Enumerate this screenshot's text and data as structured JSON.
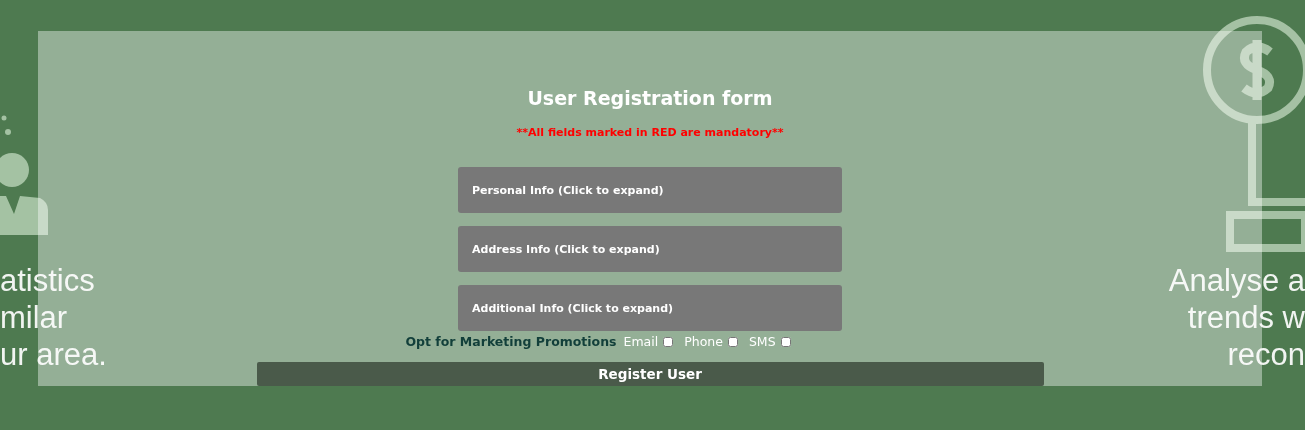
{
  "background": {
    "left_lines": [
      "atistics",
      "milar",
      "ur area."
    ],
    "right_lines": [
      "Analyse a",
      "trends w",
      "recon"
    ]
  },
  "form": {
    "title": "User Registration form",
    "notice": "**All fields marked in RED are mandatory**",
    "sections": [
      {
        "label": "Personal Info (Click to expand)"
      },
      {
        "label": "Address Info (Click to expand)"
      },
      {
        "label": "Additional Info (Click to expand)"
      }
    ],
    "marketing": {
      "label": "Opt for Marketing Promotions",
      "options": [
        {
          "label": "Email",
          "checked": false
        },
        {
          "label": "Phone",
          "checked": false
        },
        {
          "label": "SMS",
          "checked": false
        }
      ]
    },
    "submit": "Register User"
  }
}
